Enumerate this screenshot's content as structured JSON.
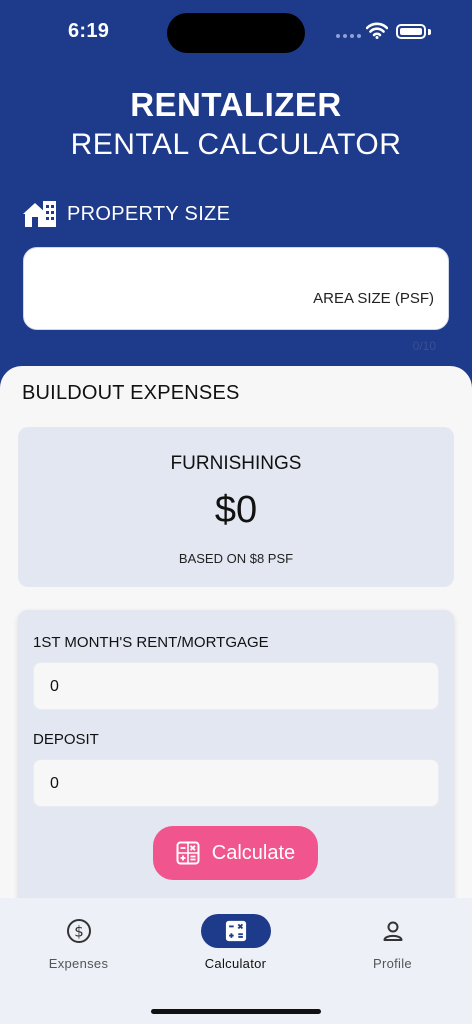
{
  "status_bar": {
    "time": "6:19"
  },
  "header": {
    "title": "RENTALIZER",
    "subtitle": "RENTAL CALCULATOR"
  },
  "property_size": {
    "label": "PROPERTY SIZE",
    "icon": "house-building-icon",
    "input_value": "",
    "placeholder": "AREA SIZE (PSF)",
    "counter": "0/10"
  },
  "buildout": {
    "title": "BUILDOUT EXPENSES",
    "furnishings": {
      "title": "FURNISHINGS",
      "value": "$0",
      "note": "BASED ON $8 PSF"
    },
    "rent": {
      "label": "1ST MONTH'S RENT/MORTGAGE",
      "value": "0"
    },
    "deposit": {
      "label": "DEPOSIT",
      "value": "0"
    },
    "calculate_label": "Calculate"
  },
  "tabs": [
    {
      "label": "Expenses",
      "icon": "dollar-circle-icon",
      "active": false
    },
    {
      "label": "Calculator",
      "icon": "calculator-icon",
      "active": true
    },
    {
      "label": "Profile",
      "icon": "person-icon",
      "active": false
    }
  ],
  "colors": {
    "primary": "#1e3a8a",
    "accent": "#f0568d",
    "card": "#e3e7f1",
    "sheet": "#f7f7f7"
  }
}
